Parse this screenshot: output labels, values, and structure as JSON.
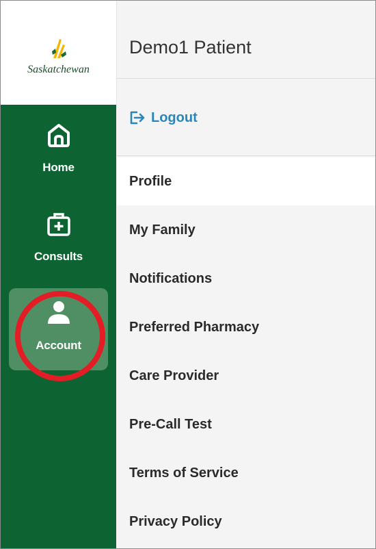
{
  "brand": {
    "name": "Saskatchewan",
    "colors": {
      "sidebar": "#0e6332",
      "sidebar_active": "#4f8f63",
      "logo_gold": "#f2b705",
      "link": "#2b86b8",
      "highlight": "#e21d26"
    }
  },
  "nav": {
    "items": [
      {
        "label": "Home",
        "icon": "home-icon"
      },
      {
        "label": "Consults",
        "icon": "medical-kit-icon"
      },
      {
        "label": "Account",
        "icon": "user-icon",
        "active": true
      }
    ]
  },
  "header": {
    "patient_name": "Demo1 Patient"
  },
  "account": {
    "logout_label": "Logout",
    "menu": [
      {
        "label": "Profile",
        "active": true
      },
      {
        "label": "My Family"
      },
      {
        "label": "Notifications"
      },
      {
        "label": "Preferred Pharmacy"
      },
      {
        "label": "Care Provider"
      },
      {
        "label": "Pre-Call Test"
      },
      {
        "label": "Terms of Service"
      },
      {
        "label": "Privacy Policy"
      }
    ]
  }
}
